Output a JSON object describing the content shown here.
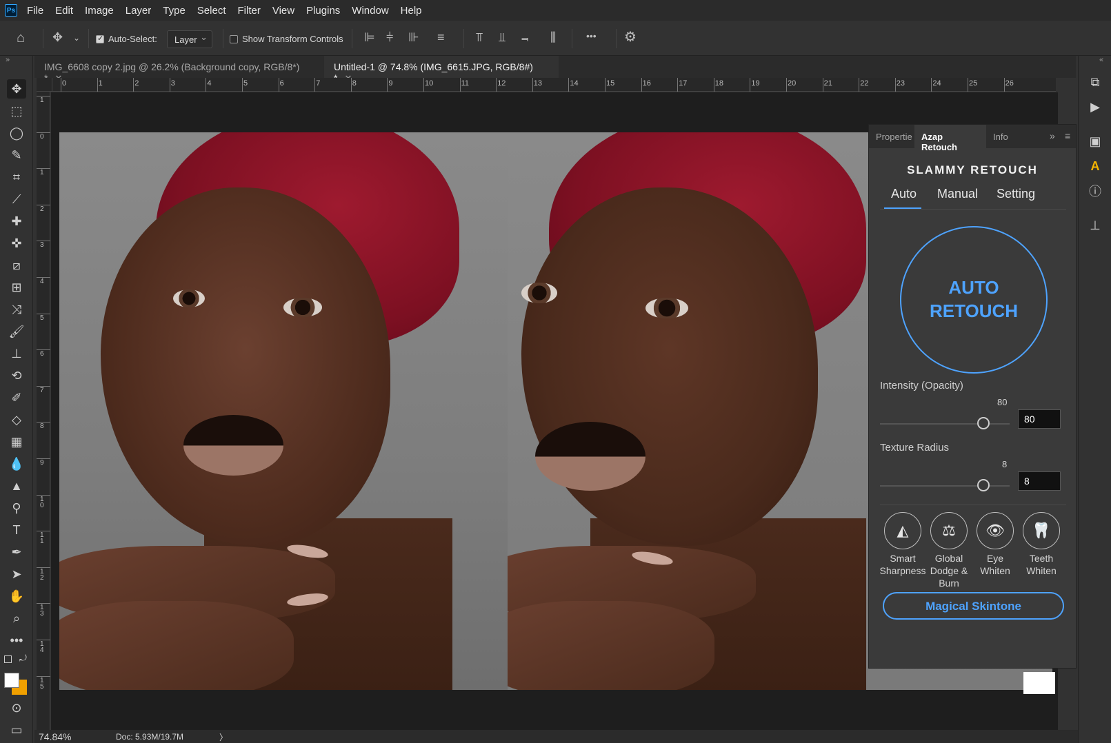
{
  "app": {
    "logo": "Ps"
  },
  "menu": [
    "File",
    "Edit",
    "Image",
    "Layer",
    "Type",
    "Select",
    "Filter",
    "View",
    "Plugins",
    "Window",
    "Help"
  ],
  "options": {
    "auto_select_label": "Auto-Select:",
    "auto_select_checked": true,
    "layer_select_value": "Layer",
    "show_transform_label": "Show Transform Controls",
    "show_transform_checked": false,
    "more_label": "•••"
  },
  "tabs": [
    {
      "label": "IMG_6608 copy 2.jpg @ 26.2% (Background copy, RGB/8*) *",
      "active": false
    },
    {
      "label": "Untitled-1 @ 74.8% (IMG_6615.JPG, RGB/8#) *",
      "active": true
    }
  ],
  "ruler": {
    "top_ticks": [
      "0",
      "1",
      "2",
      "3",
      "4",
      "5",
      "6",
      "7",
      "8",
      "9",
      "10",
      "11",
      "12",
      "13",
      "14",
      "15",
      "16",
      "17",
      "18",
      "19",
      "20",
      "21",
      "22",
      "23",
      "24",
      "25",
      "26"
    ],
    "left_ticks": [
      "1",
      "0",
      "1",
      "2",
      "3",
      "4",
      "5",
      "6",
      "7",
      "8",
      "9",
      "1 0",
      "1 1",
      "1 2",
      "1 3",
      "1 4",
      "1 5"
    ]
  },
  "panel": {
    "tabs": [
      "Propertie",
      "Azap Retouch",
      "Info"
    ],
    "active_tab": "Azap Retouch",
    "title": "SLAMMY RETOUCH",
    "modes": [
      "Auto",
      "Manual",
      "Setting"
    ],
    "active_mode": "Auto",
    "auto_button": {
      "line1": "AUTO",
      "line2": "RETOUCH"
    },
    "intensity": {
      "label": "Intensity (Opacity)",
      "value_text": "80",
      "input_value": "80",
      "value": 80,
      "max": 100
    },
    "texture": {
      "label": "Texture Radius",
      "value_text": "8",
      "input_value": "8",
      "value": 8,
      "max": 10
    },
    "tools": [
      {
        "label1": "Smart",
        "label2": "Sharpness",
        "label3": "",
        "icon": "sharpness-icon",
        "glyph": "◭"
      },
      {
        "label1": "Global",
        "label2": "Dodge &",
        "label3": "Burn",
        "icon": "scale-icon",
        "glyph": "⚖"
      },
      {
        "label1": "Eye",
        "label2": "Whiten",
        "label3": "",
        "icon": "eye-icon",
        "glyph": "👁"
      },
      {
        "label1": "Teeth",
        "label2": "Whiten",
        "label3": "",
        "icon": "tooth-icon",
        "glyph": "🦷"
      }
    ],
    "skintone_button": "Magical Skintone"
  },
  "status": {
    "zoom": "74.84%",
    "doc": "Doc: 5.93M/19.7M",
    "arrow": "〉"
  },
  "colors": {
    "accent": "#4ea3ff",
    "turban": "#8b1428",
    "bg": "#323232"
  }
}
